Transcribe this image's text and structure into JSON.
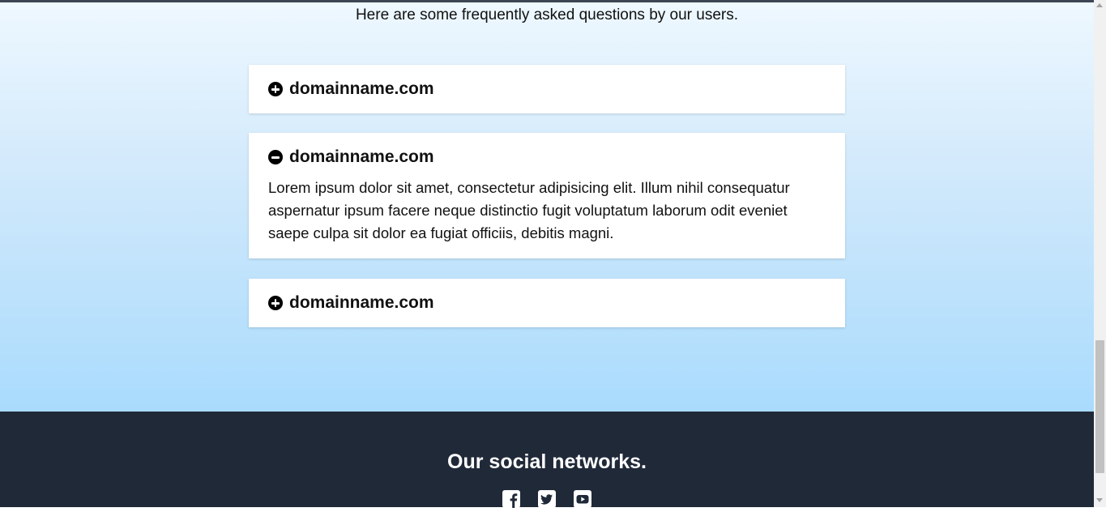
{
  "faq": {
    "intro": "Here are some frequently asked questions by our users.",
    "items": [
      {
        "title": "domainname.com",
        "state": "collapsed",
        "icon": "plus-circle-icon"
      },
      {
        "title": "domainname.com",
        "state": "expanded",
        "icon": "minus-circle-icon",
        "body": "Lorem ipsum dolor sit amet, consectetur adipisicing elit. Illum nihil consequatur aspernatur ipsum facere neque distinctio fugit voluptatum laborum odit eveniet saepe culpa sit dolor ea fugiat officiis, debitis magni."
      },
      {
        "title": "domainname.com",
        "state": "collapsed",
        "icon": "plus-circle-icon"
      }
    ]
  },
  "footer": {
    "title": "Our social networks.",
    "social": [
      {
        "icon": "facebook-icon"
      },
      {
        "icon": "twitter-icon"
      },
      {
        "icon": "youtube-icon"
      }
    ]
  },
  "colors": {
    "footer_bg": "#202938",
    "gradient_top": "#eef8ff",
    "gradient_bottom": "#a9dbfd"
  }
}
